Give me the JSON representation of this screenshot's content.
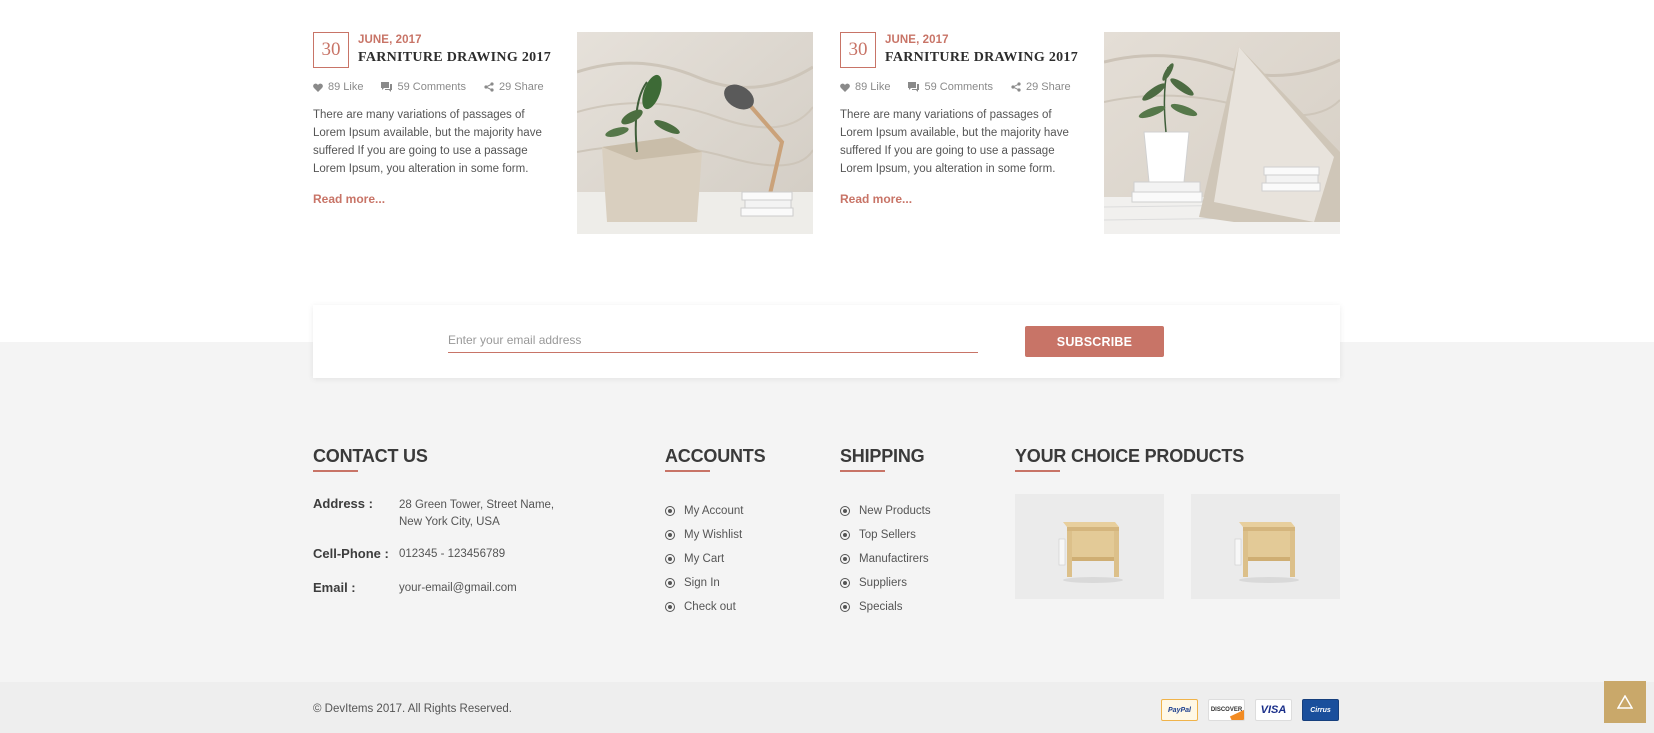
{
  "blog": {
    "posts": [
      {
        "day": "30",
        "date": "JUNE, 2017",
        "title": "FARNITURE DRAWING 2017",
        "likes": "89 Like",
        "comments": "59 Comments",
        "shares": "29 Share",
        "body": "There are many variations of passages of Lorem Ipsum available, but the majority have suffered If you are going to use a passage Lorem Ipsum, you alteration in some form.",
        "read_more": "Read more..."
      },
      {
        "day": "30",
        "date": "JUNE, 2017",
        "title": "FARNITURE DRAWING 2017",
        "likes": "89 Like",
        "comments": "59 Comments",
        "shares": "29 Share",
        "body": "There are many variations of passages of Lorem Ipsum available, but the majority have suffered If you are going to use a passage Lorem Ipsum, you alteration in some form.",
        "read_more": "Read more..."
      }
    ]
  },
  "subscribe": {
    "placeholder": "Enter your email address",
    "button": "SUBSCRIBE"
  },
  "footer": {
    "contact": {
      "title": "CONTACT US",
      "address_label": "Address :",
      "address_line1": "28 Green Tower, Street Name,",
      "address_line2": "New York City, USA",
      "phone_label": "Cell-Phone :",
      "phone": "012345 - 123456789",
      "email_label": "Email :",
      "email": "your-email@gmail.com"
    },
    "accounts": {
      "title": "ACCOUNTS",
      "items": [
        "My Account",
        "My Wishlist",
        "My Cart",
        "Sign In",
        "Check out"
      ]
    },
    "shipping": {
      "title": "SHIPPING",
      "items": [
        "New Products",
        "Top Sellers",
        "Manufactirers",
        "Suppliers",
        "Specials"
      ]
    },
    "products": {
      "title": "YOUR CHOICE PRODUCTS"
    },
    "copyright": "© DevItems 2017. All Rights Reserved.",
    "payments": {
      "paypal": "PayPal",
      "discover": "DISCOVER",
      "visa": "VISA",
      "cirrus": "Cirrus"
    }
  },
  "colors": {
    "accent": "#c87467",
    "footer_bg": "#f4f4f4",
    "scroll_top": "#c9a86a"
  },
  "icons": {
    "like": "heart-icon",
    "comments": "comment-icon",
    "share": "share-icon",
    "scroll_top": "arrow-up-icon"
  }
}
